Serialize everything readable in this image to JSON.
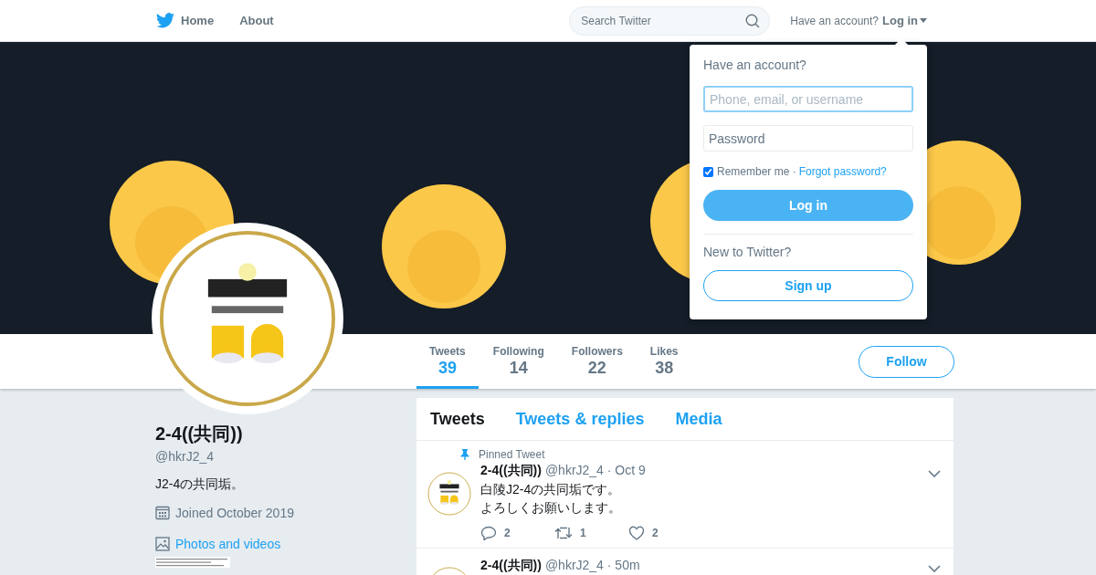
{
  "nav": {
    "items": [
      {
        "label": "Home"
      },
      {
        "label": "About"
      }
    ]
  },
  "search": {
    "placeholder": "Search Twitter"
  },
  "account": {
    "prompt": "Have an account?",
    "login": "Log in"
  },
  "login_dropdown": {
    "title": "Have an account?",
    "username_placeholder": "Phone, email, or username",
    "password_placeholder": "Password",
    "remember": {
      "label": "Remember me ·",
      "checked": true
    },
    "forgot": "Forgot password?",
    "login_button": "Log in",
    "signup_prompt": "New to Twitter?",
    "signup_button": "Sign up"
  },
  "profile": {
    "name": "2-4((共同))",
    "handle": "@hkrJ2_4",
    "bio": "J2-4の共同垢。",
    "joined": "Joined October 2019",
    "photos_link": "Photos and videos"
  },
  "stats": [
    {
      "label": "Tweets",
      "value": "39",
      "selected": true
    },
    {
      "label": "Following",
      "value": "14",
      "selected": false
    },
    {
      "label": "Followers",
      "value": "22",
      "selected": false
    },
    {
      "label": "Likes",
      "value": "38",
      "selected": false
    }
  ],
  "follow_button": "Follow",
  "timeline_tabs": [
    {
      "label": "Tweets",
      "selected": true
    },
    {
      "label": "Tweets & replies",
      "selected": false
    },
    {
      "label": "Media",
      "selected": false
    }
  ],
  "tweets": [
    {
      "pinned_label": "Pinned Tweet",
      "name": "2-4((共同))",
      "meta": "@hkrJ2_4 · Oct 9",
      "lines": [
        "白陵J2-4の共同垢です。",
        "よろしくお願いします。"
      ],
      "replies": "2",
      "retweets": "1",
      "likes": "2"
    },
    {
      "name": "2-4((共同))",
      "meta": "@hkrJ2_4 · 50m"
    }
  ]
}
